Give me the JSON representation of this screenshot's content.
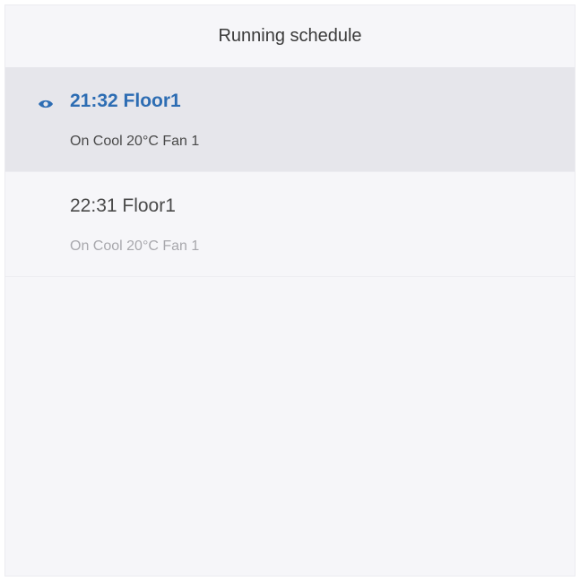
{
  "header": {
    "title": "Running schedule"
  },
  "colors": {
    "accent": "#2d6db3",
    "active_row_bg": "#e6e6eb",
    "panel_bg": "#f6f6f9"
  },
  "schedule": {
    "items": [
      {
        "title": "21:32 Floor1",
        "detail": "On Cool 20°C Fan 1",
        "active": true,
        "icon": "eye-icon"
      },
      {
        "title": "22:31 Floor1",
        "detail": "On Cool 20°C Fan 1",
        "active": false
      }
    ]
  }
}
